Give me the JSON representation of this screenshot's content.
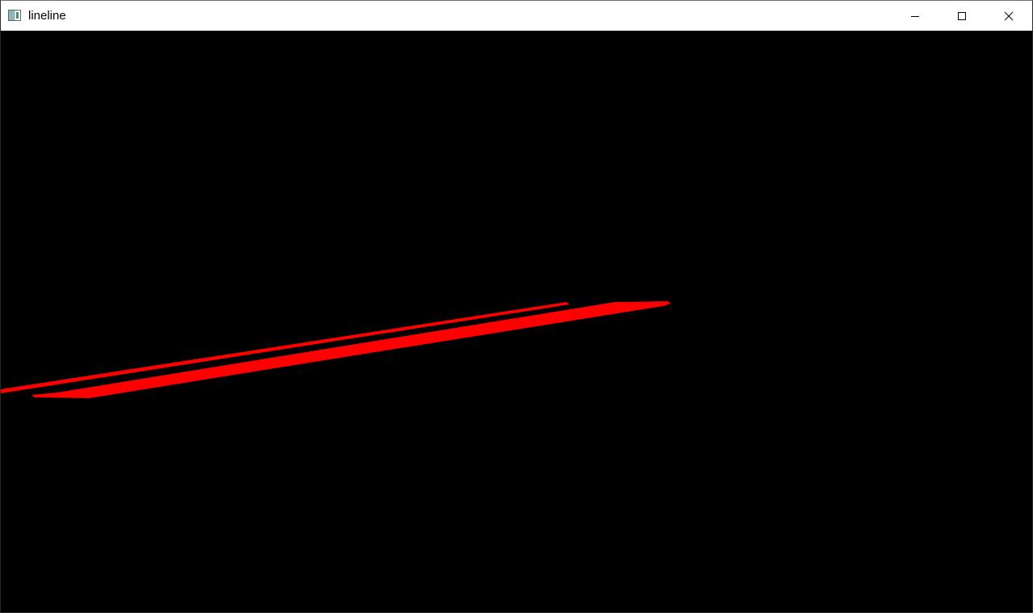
{
  "window": {
    "title": "lineline"
  },
  "titlebar": {
    "icons": {
      "app": "app-window-icon",
      "minimize": "minimize-icon",
      "maximize": "maximize-icon",
      "close": "close-icon"
    }
  },
  "canvas": {
    "background": "#000000",
    "line_color": "#ff0000",
    "lines_count_visible": 2
  }
}
